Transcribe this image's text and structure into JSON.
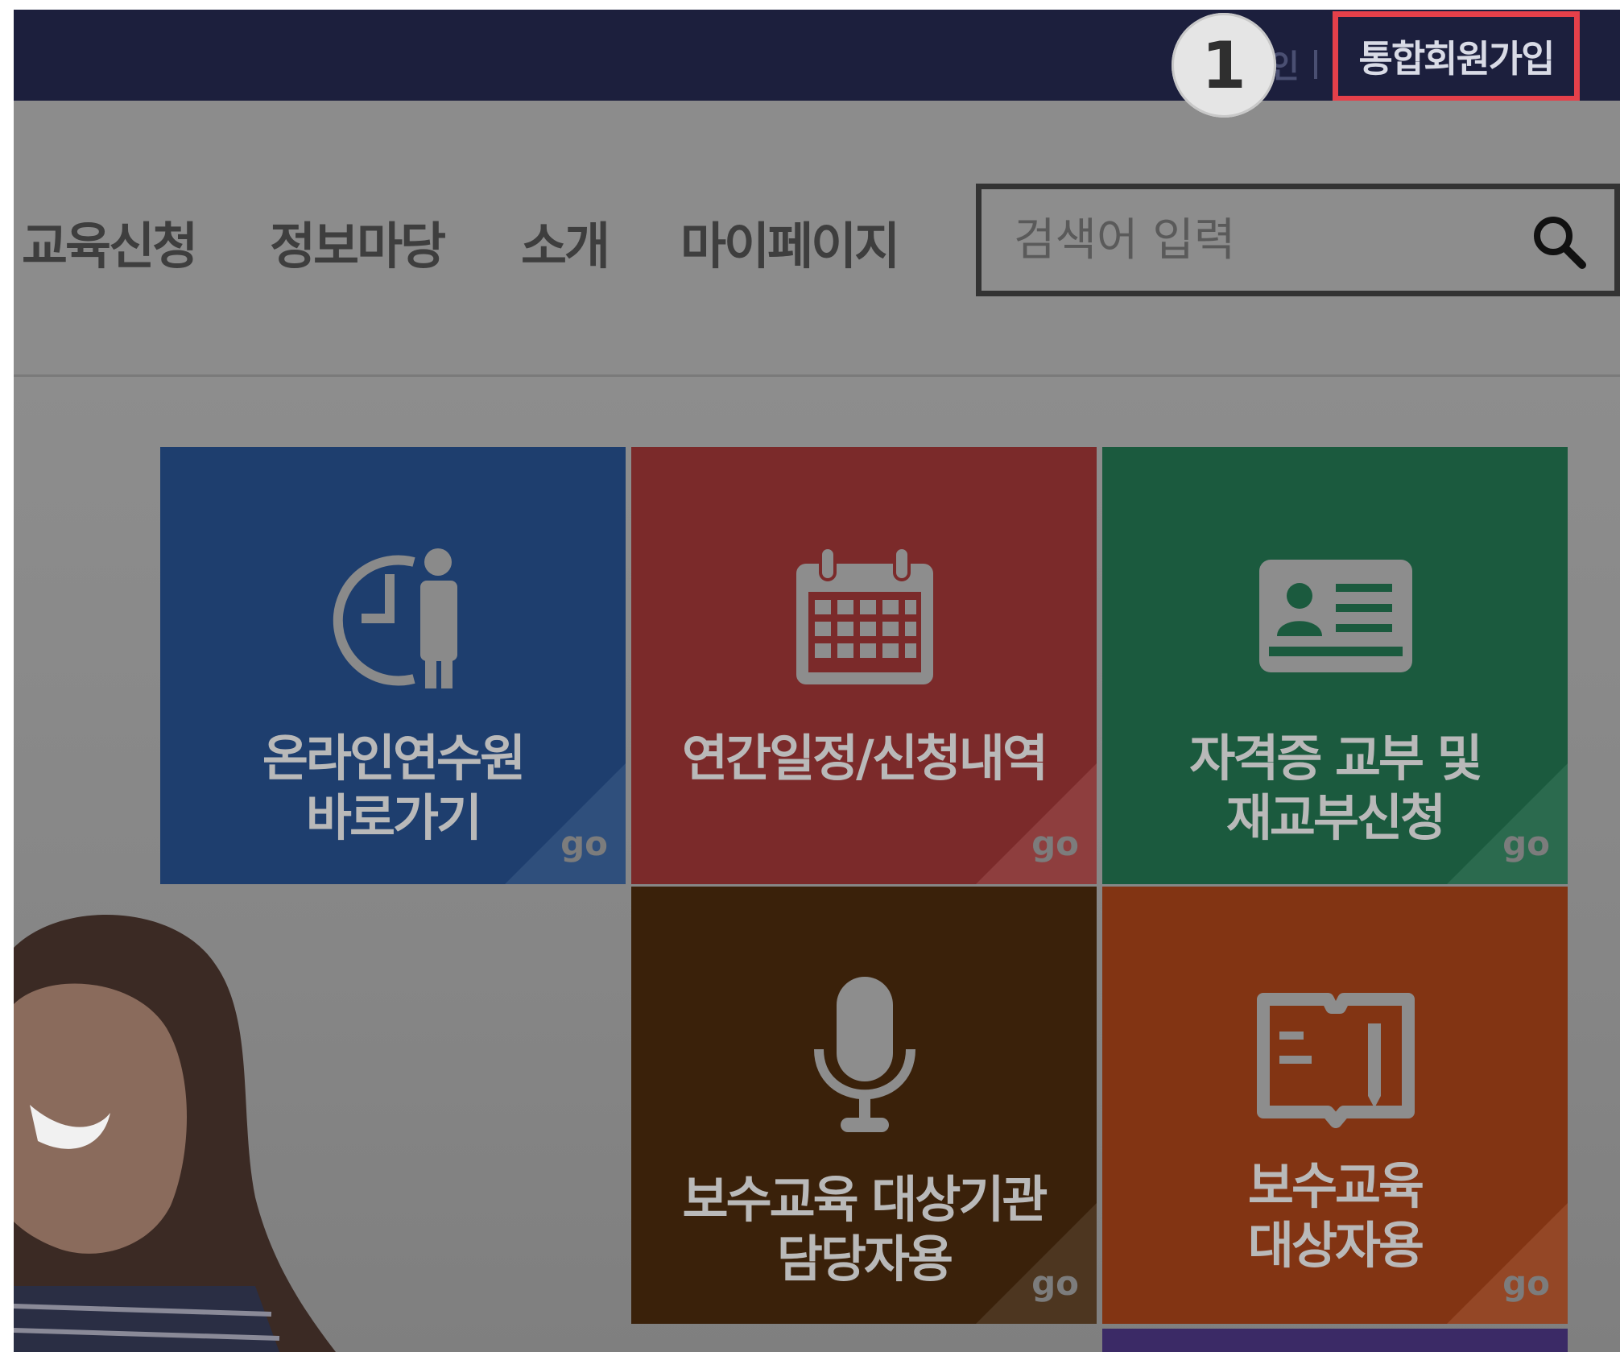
{
  "topbar": {
    "login_fragment": "인",
    "signup_label": "통합회원가입",
    "step_number": "1"
  },
  "nav": {
    "items": [
      "교육신청",
      "정보마당",
      "소개",
      "마이페이지"
    ]
  },
  "search": {
    "placeholder": "검색어 입력"
  },
  "tiles": [
    {
      "label_line1": "온라인연수원",
      "label_line2": "바로가기",
      "go": "go",
      "color": "#1e3e6e",
      "icon": "clock-person-icon"
    },
    {
      "label_line1": "연간일정/신청내역",
      "label_line2": "",
      "go": "go",
      "color": "#7b2a2a",
      "icon": "calendar-icon"
    },
    {
      "label_line1": "자격증 교부 및",
      "label_line2": "재교부신청",
      "go": "go",
      "color": "#1b5a3e",
      "icon": "id-card-icon"
    },
    {
      "label_line1": "보수교육 대상기관",
      "label_line2": "담당자용",
      "go": "go",
      "color": "#3a210a",
      "icon": "microphone-icon"
    },
    {
      "label_line1": "보수교육",
      "label_line2": "대상자용",
      "go": "go",
      "color": "#823413",
      "icon": "book-icon"
    }
  ]
}
